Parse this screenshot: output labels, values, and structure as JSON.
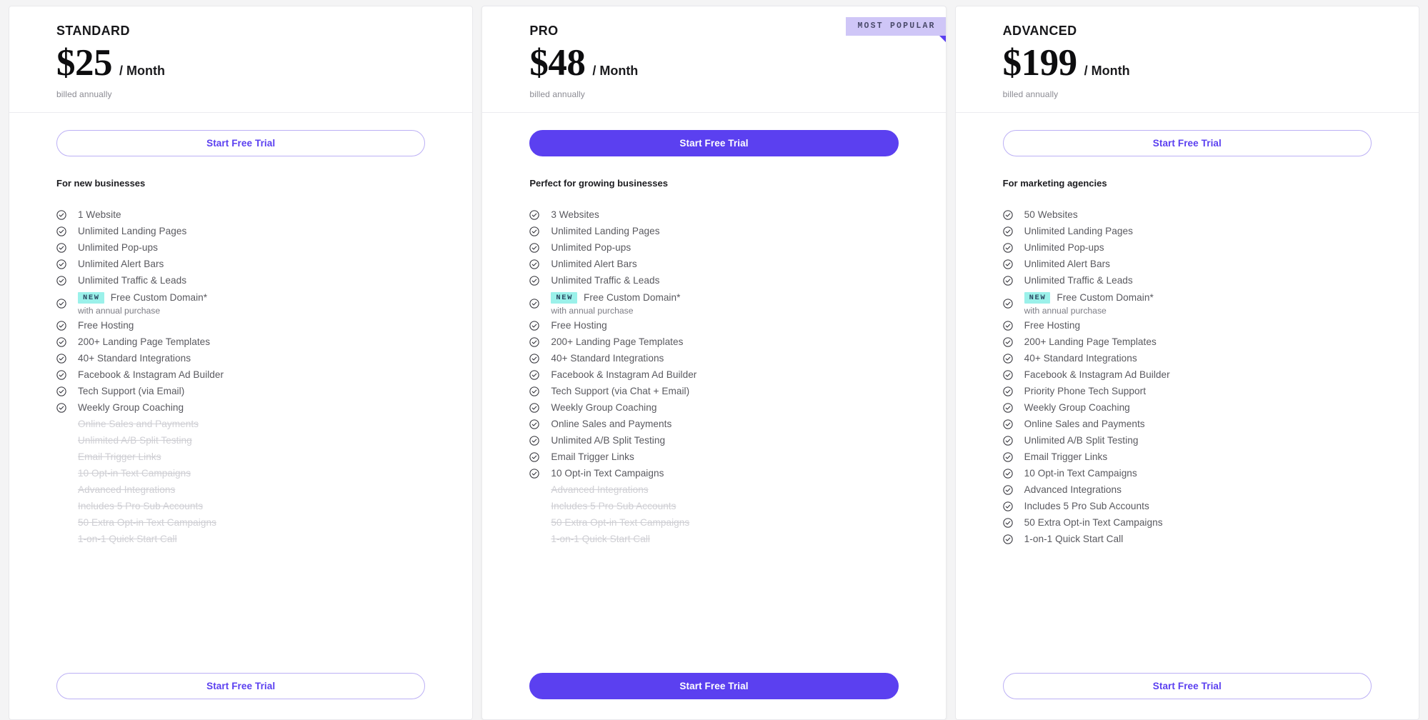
{
  "colors": {
    "brand_purple": "#5B40F0",
    "badge_lilac": "#CFC6F7",
    "new_badge_cyan": "#9BF1EA",
    "page_bg": "#F4F4F5"
  },
  "cta": {
    "top_label": "Start Free Trial",
    "bottom_label": "Start Free Trial"
  },
  "badges": {
    "most_popular": "MOST POPULAR",
    "new": "NEW"
  },
  "plans": [
    {
      "name": "STANDARD",
      "price": "$25",
      "period": "/ Month",
      "billing_note": "billed annually",
      "tagline": "For new businesses",
      "highlighted": false,
      "popular": false,
      "features": [
        {
          "label": "1 Website",
          "included": true
        },
        {
          "label": "Unlimited Landing Pages",
          "included": true
        },
        {
          "label": "Unlimited Pop-ups",
          "included": true
        },
        {
          "label": "Unlimited Alert Bars",
          "included": true
        },
        {
          "label": "Unlimited Traffic & Leads",
          "included": true
        },
        {
          "label": "Free Custom Domain*",
          "sublabel": "with annual purchase",
          "badge": "NEW",
          "included": true
        },
        {
          "label": "Free Hosting",
          "included": true
        },
        {
          "label": "200+ Landing Page Templates",
          "included": true
        },
        {
          "label": "40+ Standard Integrations",
          "included": true
        },
        {
          "label": "Facebook & Instagram Ad Builder",
          "included": true
        },
        {
          "label": "Tech Support (via Email)",
          "included": true
        },
        {
          "label": "Weekly Group Coaching",
          "included": true
        },
        {
          "label": "Online Sales and Payments",
          "included": false
        },
        {
          "label": "Unlimited A/B Split Testing",
          "included": false
        },
        {
          "label": "Email Trigger Links",
          "included": false
        },
        {
          "label": "10 Opt-in Text Campaigns",
          "included": false
        },
        {
          "label": "Advanced Integrations",
          "included": false
        },
        {
          "label": "Includes 5 Pro Sub Accounts",
          "included": false
        },
        {
          "label": "50 Extra Opt-in Text Campaigns",
          "included": false
        },
        {
          "label": "1-on-1 Quick Start Call",
          "included": false
        }
      ]
    },
    {
      "name": "PRO",
      "price": "$48",
      "period": "/ Month",
      "billing_note": "billed annually",
      "tagline": "Perfect for growing businesses",
      "highlighted": true,
      "popular": true,
      "features": [
        {
          "label": "3 Websites",
          "included": true
        },
        {
          "label": "Unlimited Landing Pages",
          "included": true
        },
        {
          "label": "Unlimited Pop-ups",
          "included": true
        },
        {
          "label": "Unlimited Alert Bars",
          "included": true
        },
        {
          "label": "Unlimited Traffic & Leads",
          "included": true
        },
        {
          "label": "Free Custom Domain*",
          "sublabel": "with annual purchase",
          "badge": "NEW",
          "included": true
        },
        {
          "label": "Free Hosting",
          "included": true
        },
        {
          "label": "200+ Landing Page Templates",
          "included": true
        },
        {
          "label": "40+ Standard Integrations",
          "included": true
        },
        {
          "label": "Facebook & Instagram Ad Builder",
          "included": true
        },
        {
          "label": "Tech Support (via Chat + Email)",
          "included": true
        },
        {
          "label": "Weekly Group Coaching",
          "included": true
        },
        {
          "label": "Online Sales and Payments",
          "included": true
        },
        {
          "label": "Unlimited A/B Split Testing",
          "included": true
        },
        {
          "label": "Email Trigger Links",
          "included": true
        },
        {
          "label": "10 Opt-in Text Campaigns",
          "included": true
        },
        {
          "label": "Advanced Integrations",
          "included": false
        },
        {
          "label": "Includes 5 Pro Sub Accounts",
          "included": false
        },
        {
          "label": "50 Extra Opt-in Text Campaigns",
          "included": false
        },
        {
          "label": "1-on-1 Quick Start Call",
          "included": false
        }
      ]
    },
    {
      "name": "ADVANCED",
      "price": "$199",
      "period": "/ Month",
      "billing_note": "billed annually",
      "tagline": "For marketing agencies",
      "highlighted": false,
      "popular": false,
      "features": [
        {
          "label": "50 Websites",
          "included": true
        },
        {
          "label": "Unlimited Landing Pages",
          "included": true
        },
        {
          "label": "Unlimited Pop-ups",
          "included": true
        },
        {
          "label": "Unlimited Alert Bars",
          "included": true
        },
        {
          "label": "Unlimited Traffic & Leads",
          "included": true
        },
        {
          "label": "Free Custom Domain*",
          "sublabel": "with annual purchase",
          "badge": "NEW",
          "included": true
        },
        {
          "label": "Free Hosting",
          "included": true
        },
        {
          "label": "200+ Landing Page Templates",
          "included": true
        },
        {
          "label": "40+ Standard Integrations",
          "included": true
        },
        {
          "label": "Facebook & Instagram Ad Builder",
          "included": true
        },
        {
          "label": "Priority Phone Tech Support",
          "included": true
        },
        {
          "label": "Weekly Group Coaching",
          "included": true
        },
        {
          "label": "Online Sales and Payments",
          "included": true
        },
        {
          "label": "Unlimited A/B Split Testing",
          "included": true
        },
        {
          "label": "Email Trigger Links",
          "included": true
        },
        {
          "label": "10 Opt-in Text Campaigns",
          "included": true
        },
        {
          "label": "Advanced Integrations",
          "included": true
        },
        {
          "label": "Includes 5 Pro Sub Accounts",
          "included": true
        },
        {
          "label": "50 Extra Opt-in Text Campaigns",
          "included": true
        },
        {
          "label": "1-on-1 Quick Start Call",
          "included": true
        }
      ]
    }
  ]
}
